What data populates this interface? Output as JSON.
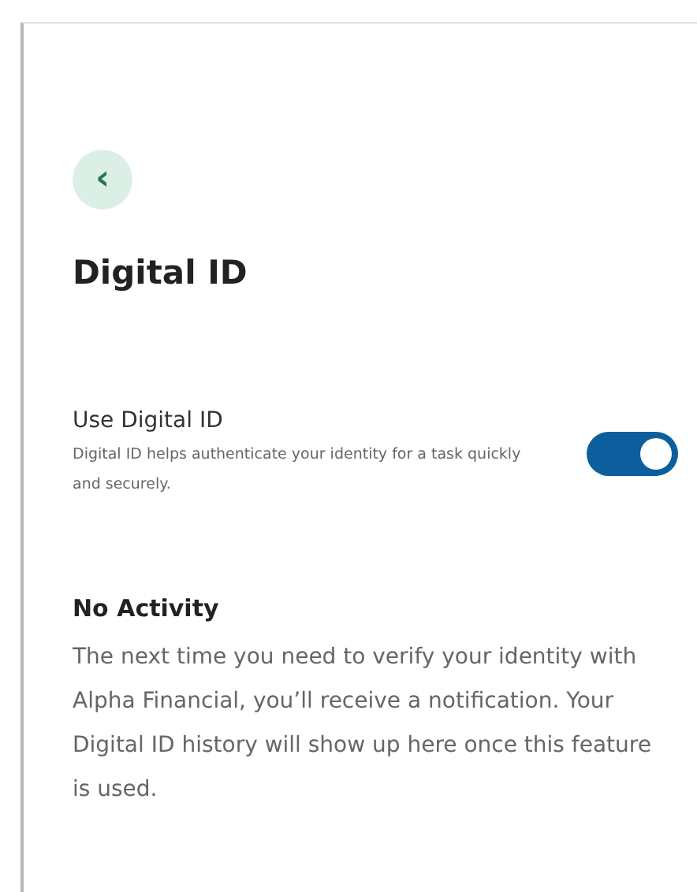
{
  "header": {
    "back_button": "‹",
    "title": "Digital ID"
  },
  "setting": {
    "label": "Use Digital ID",
    "description": "Digital ID helps authenticate your identity for a task quickly and securely.",
    "on": true
  },
  "activity": {
    "heading": "No Activity",
    "message": "The next time you need to verify your identity with Alpha Financial, you’ll receive a notification. Your Digital ID history will show up here once this feature is used."
  }
}
